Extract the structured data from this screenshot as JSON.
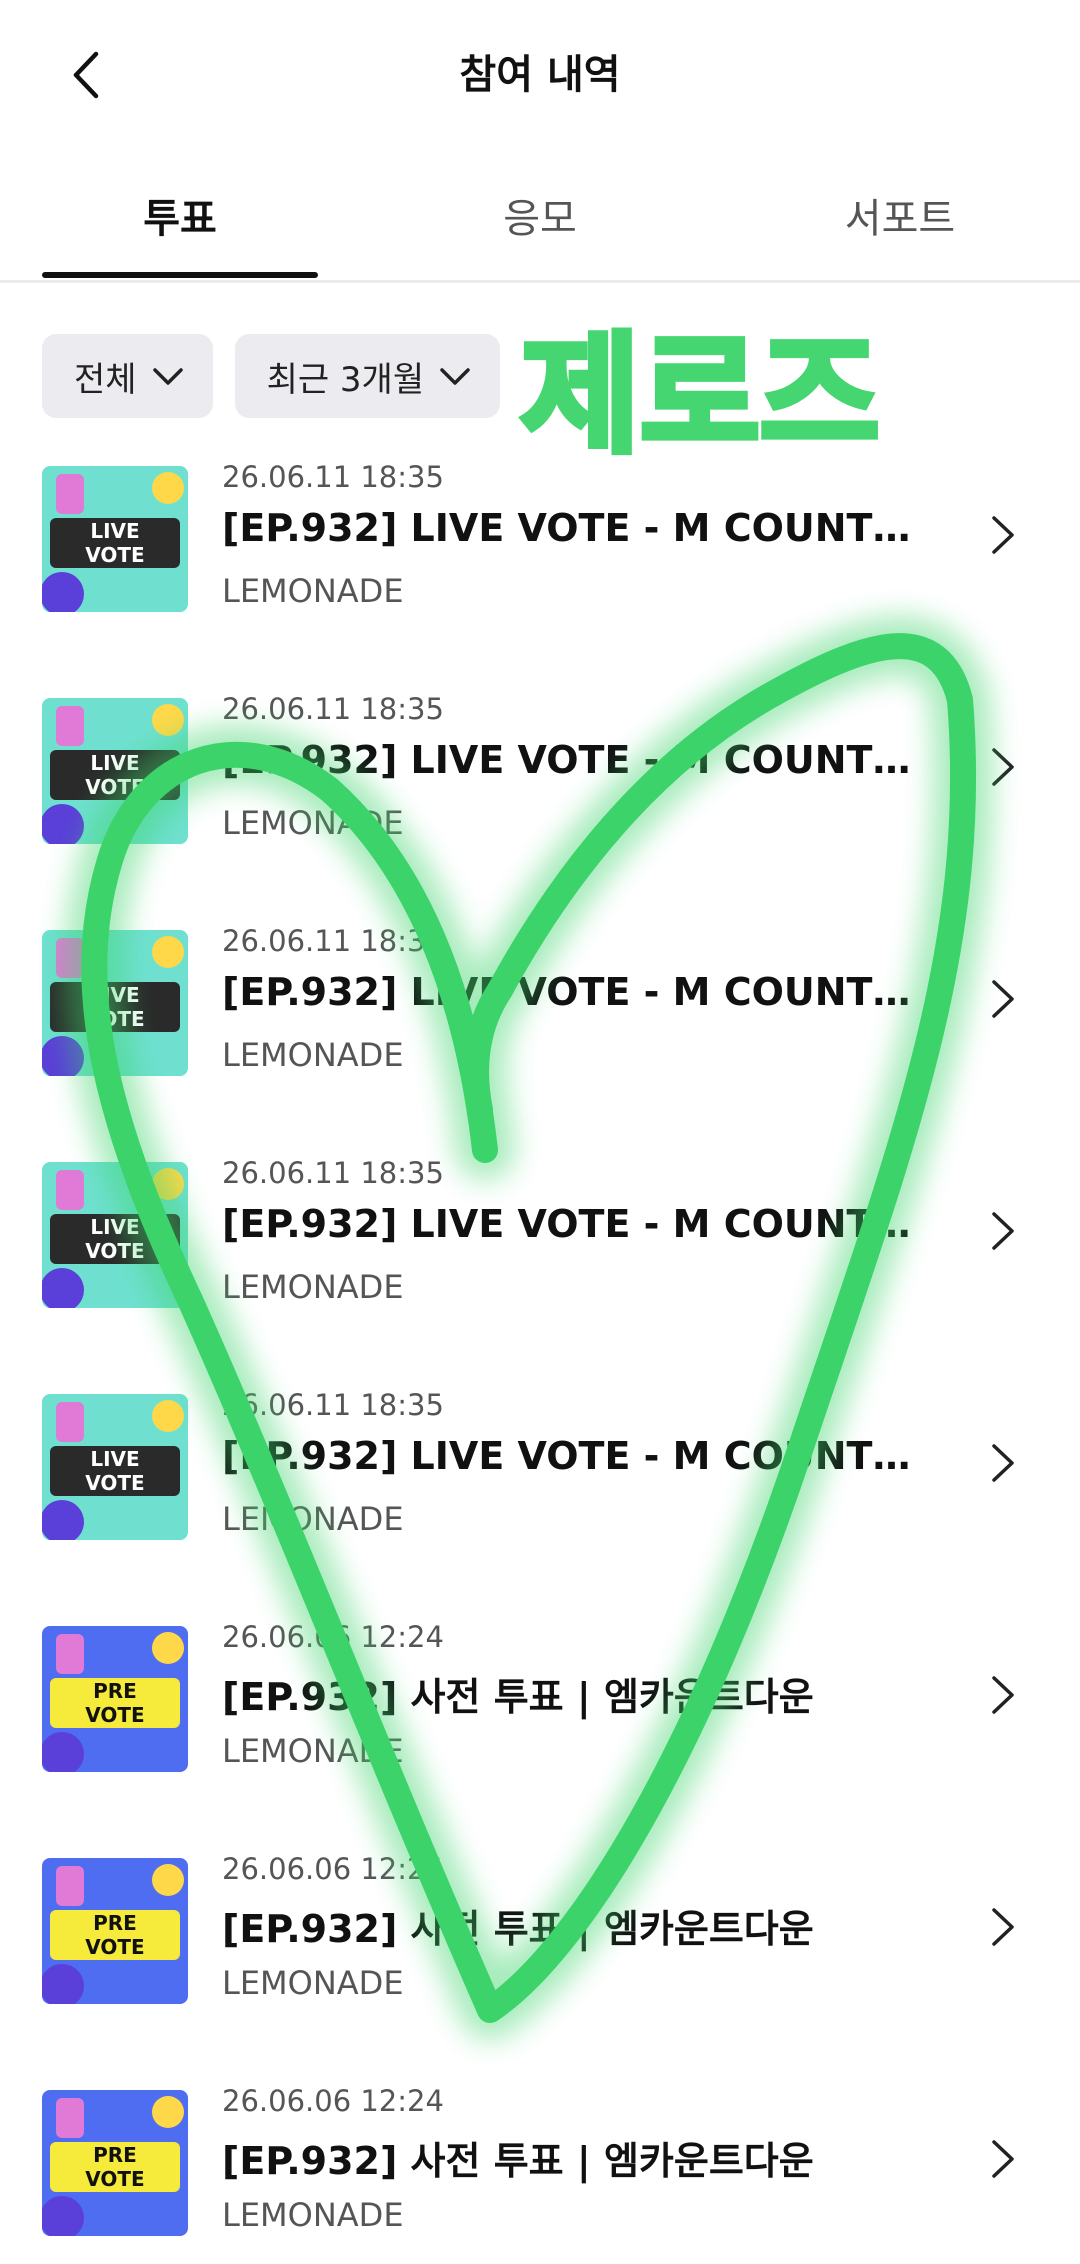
{
  "header": {
    "title": "참여 내역",
    "back_icon": "chevron-left-icon"
  },
  "tabs": [
    {
      "label": "투표",
      "active": true
    },
    {
      "label": "응모",
      "active": false
    },
    {
      "label": "서포트",
      "active": false
    }
  ],
  "filters": [
    {
      "label": "전체",
      "icon": "chevron-down-icon"
    },
    {
      "label": "최근 3개월",
      "icon": "chevron-down-icon"
    }
  ],
  "entries": [
    {
      "date": "26.06.11 18:35",
      "title": "[EP.932] LIVE VOTE - M COUNTDO...",
      "subtitle": "LEMONADE",
      "thumb_line1": "LIVE",
      "thumb_line2": "VOTE"
    },
    {
      "date": "26.06.11 18:35",
      "title": "[EP.932] LIVE VOTE - M COUNTDO...",
      "subtitle": "LEMONADE",
      "thumb_line1": "LIVE",
      "thumb_line2": "VOTE"
    },
    {
      "date": "26.06.11 18:35",
      "title": "[EP.932] LIVE VOTE - M COUNTDO...",
      "subtitle": "LEMONADE",
      "thumb_line1": "LIVE",
      "thumb_line2": "VOTE"
    },
    {
      "date": "26.06.11 18:35",
      "title": "[EP.932] LIVE VOTE - M COUNTDO...",
      "subtitle": "LEMONADE",
      "thumb_line1": "LIVE",
      "thumb_line2": "VOTE"
    },
    {
      "date": "26.06.11 18:35",
      "title": "[EP.932] LIVE VOTE - M COUNTDO...",
      "subtitle": "LEMONADE",
      "thumb_line1": "LIVE",
      "thumb_line2": "VOTE"
    },
    {
      "date": "26.06.06 12:24",
      "title": "[EP.932] 사전 투표 | 엠카운트다운",
      "subtitle": "LEMONADE",
      "thumb_line1": "PRE",
      "thumb_line2": "VOTE"
    },
    {
      "date": "26.06.06 12:24",
      "title": "[EP.932] 사전 투표 | 엠카운트다운",
      "subtitle": "LEMONADE",
      "thumb_line1": "PRE",
      "thumb_line2": "VOTE"
    },
    {
      "date": "26.06.06 12:24",
      "title": "[EP.932] 사전 투표 | 엠카운트다운",
      "subtitle": "LEMONADE",
      "thumb_line1": "PRE",
      "thumb_line2": "VOTE"
    }
  ],
  "overlay": {
    "handwriting_text": "제로즈",
    "color": "#3cd46a"
  }
}
